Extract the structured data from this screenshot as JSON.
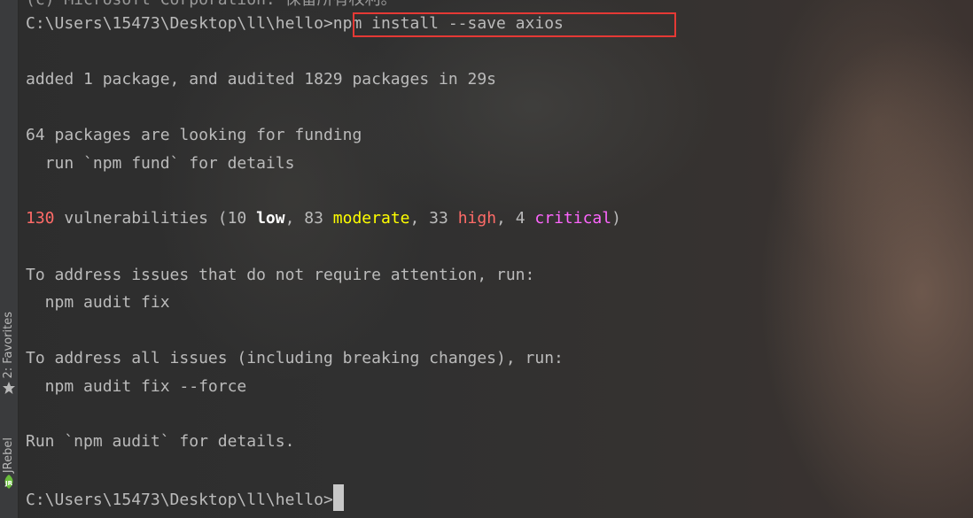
{
  "left_toolbar": {
    "favorites_label": "2: Favorites",
    "jrebel_label": "JRebel",
    "favorites_icon": "star-icon",
    "jrebel_icon": "jrebel-icon"
  },
  "terminal": {
    "top_partial_line": "(c) Microsoft Corporation. 保留所有权利。",
    "prompt_1": "C:\\Users\\15473\\Desktop\\ll\\hello>",
    "command_1": "npm install --save axios",
    "added_line": "added 1 package, and audited 1829 packages in 29s",
    "funding_line_1": "64 packages are looking for funding",
    "funding_line_2": "  run `npm fund` for details",
    "vuln": {
      "count": "130",
      "text_1": " vulnerabilities (10 ",
      "low": "low",
      "text_2": ", 83 ",
      "moderate": "moderate",
      "text_3": ", 33 ",
      "high": "high",
      "text_4": ", 4 ",
      "critical": "critical",
      "text_5": ")"
    },
    "address_1": "To address issues that do not require attention, run:",
    "address_1_cmd": "  npm audit fix",
    "address_2": "To address all issues (including breaking changes), run:",
    "address_2_cmd": "  npm audit fix --force",
    "audit_details": "Run `npm audit` for details.",
    "prompt_2": "C:\\Users\\15473\\Desktop\\ll\\hello>"
  },
  "colors": {
    "terminal_text": "#bbbbbb",
    "count_red": "#ff6b68",
    "moderate_yellow": "#ffff00",
    "high_red": "#ff6b68",
    "critical_magenta": "#ff66ff",
    "highlight_box": "#e53935"
  }
}
